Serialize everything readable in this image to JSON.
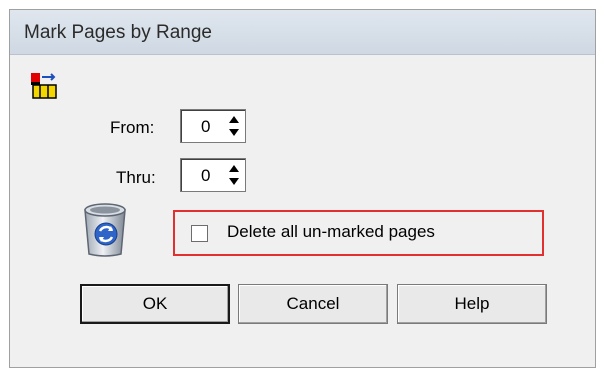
{
  "window": {
    "title": "Mark Pages by Range"
  },
  "icons": {
    "app": "mark-pages-icon",
    "trash": "recycle-bin-icon",
    "spin_up": "arrow-up-icon",
    "spin_down": "arrow-down-icon"
  },
  "fields": {
    "from": {
      "label": "From:",
      "value": "0"
    },
    "thru": {
      "label": "Thru:",
      "value": "0"
    }
  },
  "option": {
    "label": "Delete all un-marked pages",
    "checked": false
  },
  "buttons": {
    "ok": "OK",
    "cancel": "Cancel",
    "help": "Help"
  },
  "colors": {
    "highlight_border": "#e03030",
    "dialog_bg": "#f0f0f0"
  }
}
